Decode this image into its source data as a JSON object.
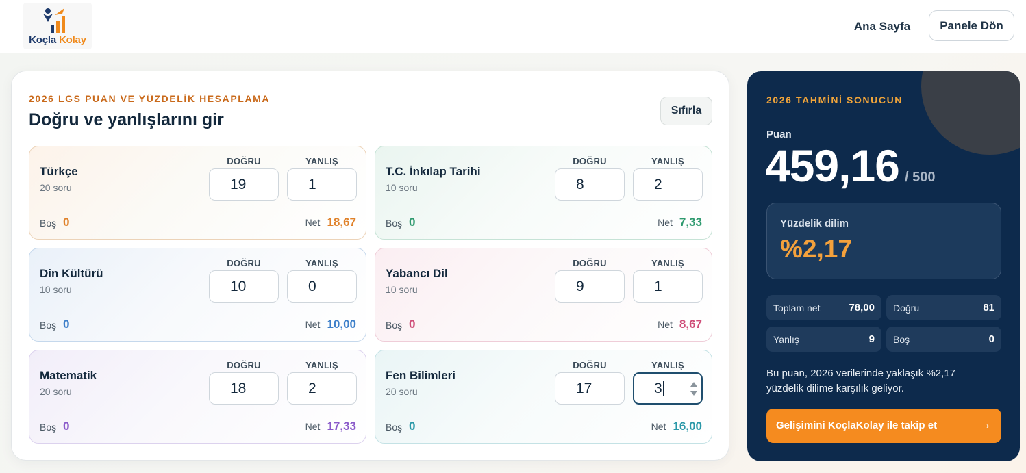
{
  "header": {
    "logo_text_a": "Koçla",
    "logo_text_b": "Kolay",
    "nav_home": "Ana Sayfa",
    "nav_panel": "Panele Dön"
  },
  "calculator": {
    "eyebrow": "2026 LGS PUAN VE YÜZDELİK HESAPLAMA",
    "title": "Doğru ve yanlışlarını gir",
    "reset_label": "Sıfırla",
    "col_dogru": "DOĞRU",
    "col_yanlis": "YANLIŞ",
    "bos_label": "Boş",
    "net_label": "Net",
    "subjects": [
      {
        "name": "Türkçe",
        "count": "20 soru",
        "dogru": "19",
        "yanlis": "1",
        "bos": "0",
        "net": "18,67",
        "accent": "#e0822b"
      },
      {
        "name": "T.C. İnkılap Tarihi",
        "count": "10 soru",
        "dogru": "8",
        "yanlis": "2",
        "bos": "0",
        "net": "7,33",
        "accent": "#2f9a6f"
      },
      {
        "name": "Din Kültürü",
        "count": "10 soru",
        "dogru": "10",
        "yanlis": "0",
        "bos": "0",
        "net": "10,00",
        "accent": "#3d7fc9"
      },
      {
        "name": "Yabancı Dil",
        "count": "10 soru",
        "dogru": "9",
        "yanlis": "1",
        "bos": "0",
        "net": "8,67",
        "accent": "#cf4d78"
      },
      {
        "name": "Matematik",
        "count": "20 soru",
        "dogru": "18",
        "yanlis": "2",
        "bos": "0",
        "net": "17,33",
        "accent": "#8a5ac9"
      },
      {
        "name": "Fen Bilimleri",
        "count": "20 soru",
        "dogru": "17",
        "yanlis": "3",
        "bos": "0",
        "net": "16,00",
        "accent": "#2a98a8"
      }
    ]
  },
  "result": {
    "eyebrow": "2026 TAHMİNİ SONUCUN",
    "puan_label": "Puan",
    "puan": "459,16",
    "max": "/ 500",
    "pct_label": "Yüzdelik dilim",
    "pct": "%2,17",
    "stats": {
      "toplam_net_label": "Toplam net",
      "toplam_net": "78,00",
      "dogru_label": "Doğru",
      "dogru": "81",
      "yanlis_label": "Yanlış",
      "yanlis": "9",
      "bos_label": "Boş",
      "bos": "0"
    },
    "note": "Bu puan, 2026 verilerinde yaklaşık %2,17 yüzdelik dilime karşılık geliyor.",
    "cta_label": "Gelişimini KoçlaKolay ile takip et",
    "cta_arrow": "→"
  },
  "colors": {
    "brand_navy": "#0d2a4c",
    "brand_orange": "#f58b1f"
  }
}
